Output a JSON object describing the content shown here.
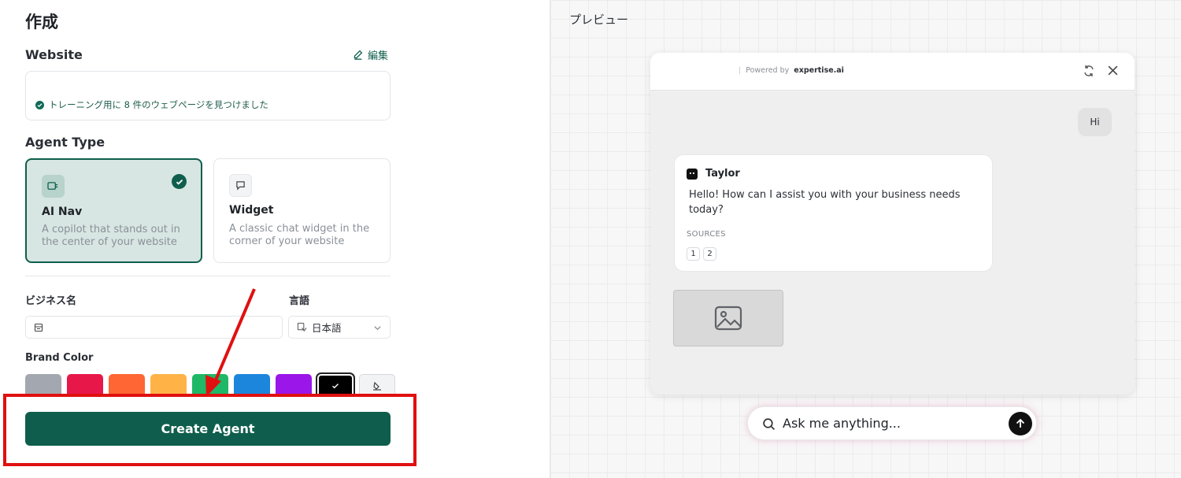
{
  "left": {
    "heading": "作成",
    "website": {
      "label": "Website",
      "edit_label": "編集",
      "status_text": "トレーニング用に 8 件のウェブページを見つけました"
    },
    "agent_type": {
      "label": "Agent Type",
      "options": [
        {
          "title": "AI Nav",
          "description": "A copilot that stands out in the center of your website",
          "selected": true
        },
        {
          "title": "Widget",
          "description": "A classic chat widget in the corner of your website",
          "selected": false
        }
      ]
    },
    "business_name": {
      "label": "ビジネス名",
      "value": ""
    },
    "language": {
      "label": "言語",
      "value": "日本語"
    },
    "brand_color": {
      "label": "Brand Color",
      "swatches": [
        "#a3a8b0",
        "#e8174a",
        "#ff6633",
        "#ffb347",
        "#1fb866",
        "#1c86dc",
        "#9b16e8",
        "#000000"
      ],
      "selected": "#000000"
    },
    "create_button": "Create Agent"
  },
  "right": {
    "preview_label": "プレビュー",
    "widget": {
      "powered_by": "Powered by",
      "brand": "expertise.ai",
      "user_message": "Hi",
      "bot_name": "Taylor",
      "bot_message": "Hello! How can I assist you with your business needs today?",
      "sources_label": "SOURCES",
      "sources": [
        "1",
        "2"
      ]
    },
    "ask_placeholder": "Ask me anything..."
  },
  "colors": {
    "primary": "#0f5e4d",
    "annotation": "#e01010"
  }
}
